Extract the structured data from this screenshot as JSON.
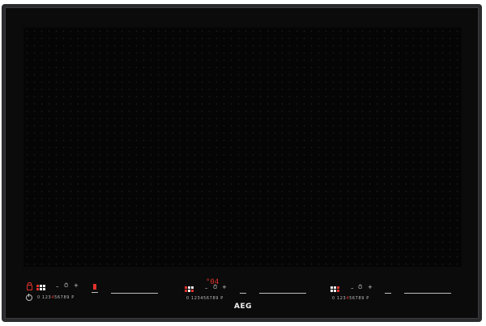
{
  "brand": "AEG",
  "colors": {
    "frame": "#2b2b2e",
    "glass": "#050505",
    "accent": "#e0322b",
    "text": "#d9d9d9"
  },
  "timer_display": "°04",
  "zones": [
    {
      "minus": "–",
      "timer_icon": "⏱",
      "plus": "+",
      "levels": [
        "0",
        "1",
        "2",
        "3",
        "4",
        "5",
        "6",
        "7",
        "8",
        "9",
        "P"
      ],
      "active_level": "4"
    },
    {
      "minus": "–",
      "timer_icon": "⏱",
      "plus": "+",
      "levels": [
        "0",
        "1",
        "2",
        "3",
        "4",
        "5",
        "6",
        "7",
        "8",
        "9",
        "P"
      ],
      "active_level": ""
    },
    {
      "minus": "–",
      "timer_icon": "⏱",
      "plus": "+",
      "levels": [
        "0",
        "1",
        "2",
        "3",
        "4",
        "5",
        "6",
        "7",
        "8",
        "9",
        "P"
      ],
      "active_level": "4"
    }
  ],
  "icons": [
    "lock-icon",
    "power-icon",
    "bridge-icon",
    "zone-grid-icon"
  ]
}
